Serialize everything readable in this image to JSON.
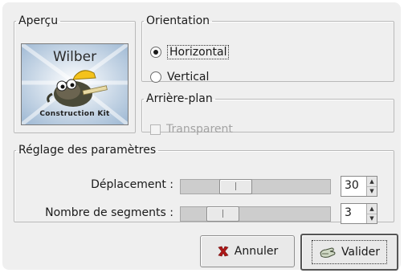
{
  "apercu": {
    "legend": "Aperçu",
    "preview_top_text": "Wilber",
    "preview_bottom_text": "Construction Kit"
  },
  "orientation": {
    "legend": "Orientation",
    "options": [
      {
        "label": "Horizontal",
        "selected": true
      },
      {
        "label": "Vertical",
        "selected": false
      }
    ]
  },
  "arriere_plan": {
    "legend": "Arrière-plan",
    "transparent_label": "Transparent",
    "transparent_checked": false,
    "transparent_enabled": false
  },
  "parametres": {
    "legend": "Réglage des paramètres",
    "deplacement": {
      "label": "Déplacement :",
      "value": "30"
    },
    "segments": {
      "label": "Nombre de segments :",
      "value": "3"
    }
  },
  "buttons": {
    "cancel": {
      "label": "Annuler",
      "icon": "x-icon"
    },
    "ok": {
      "label": "Valider",
      "icon": "hand-check-icon"
    }
  }
}
